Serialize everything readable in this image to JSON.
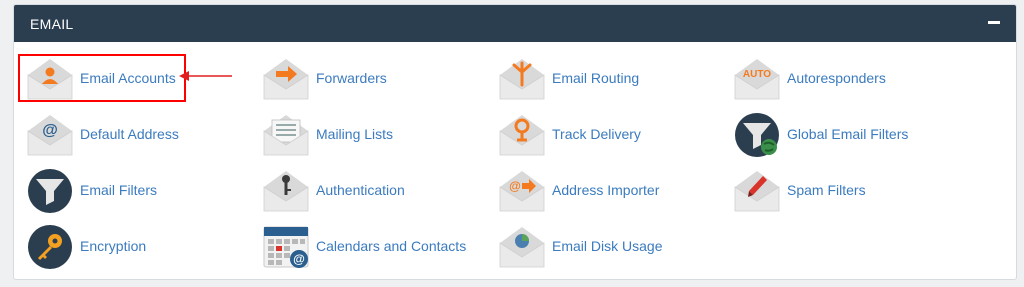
{
  "section": {
    "title": "EMAIL"
  },
  "items": [
    {
      "label": "Email Accounts",
      "icon": "email-accounts-icon"
    },
    {
      "label": "Forwarders",
      "icon": "forwarders-icon"
    },
    {
      "label": "Email Routing",
      "icon": "email-routing-icon"
    },
    {
      "label": "Autoresponders",
      "icon": "autoresponders-icon",
      "icon_text": "AUTO"
    },
    {
      "label": "Default Address",
      "icon": "default-address-icon",
      "icon_text": "@"
    },
    {
      "label": "Mailing Lists",
      "icon": "mailing-lists-icon"
    },
    {
      "label": "Track Delivery",
      "icon": "track-delivery-icon"
    },
    {
      "label": "Global Email Filters",
      "icon": "global-email-filters-icon"
    },
    {
      "label": "Email Filters",
      "icon": "email-filters-icon"
    },
    {
      "label": "Authentication",
      "icon": "authentication-icon"
    },
    {
      "label": "Address Importer",
      "icon": "address-importer-icon",
      "icon_text": "@"
    },
    {
      "label": "Spam Filters",
      "icon": "spam-filters-icon"
    },
    {
      "label": "Encryption",
      "icon": "encryption-icon"
    },
    {
      "label": "Calendars and Contacts",
      "icon": "calendars-contacts-icon",
      "icon_text": "@"
    },
    {
      "label": "Email Disk Usage",
      "icon": "email-disk-usage-icon"
    }
  ],
  "colors": {
    "header_bg": "#2b3e50",
    "link": "#3b7bbf",
    "accent_orange": "#f47a20",
    "highlight": "#ff0000"
  }
}
